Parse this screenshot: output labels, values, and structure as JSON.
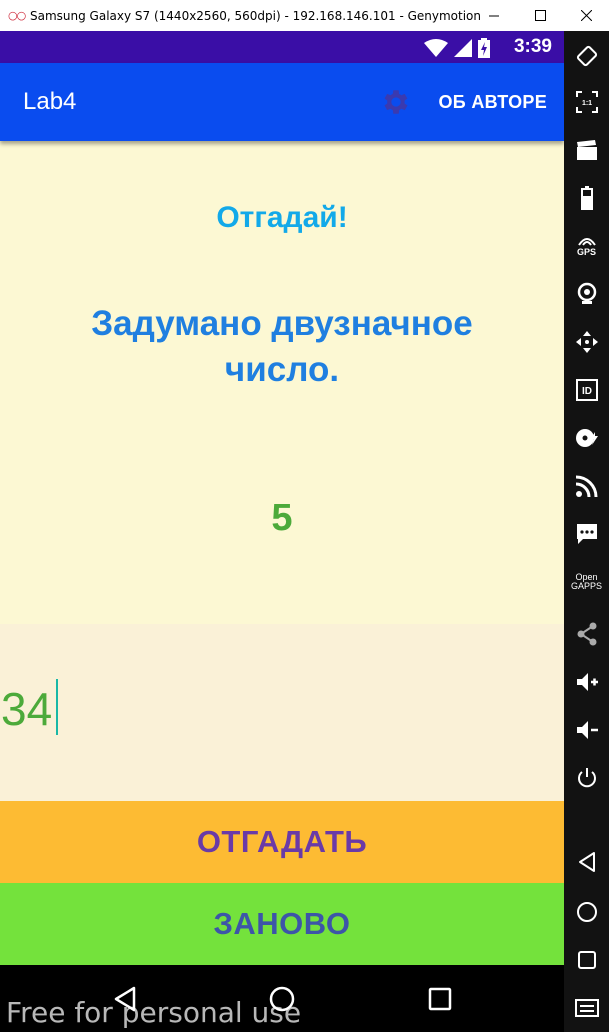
{
  "window": {
    "title": "Samsung Galaxy S7 (1440x2560, 560dpi) - 192.168.146.101 - Genymotion",
    "app_icon": "genymotion-icon",
    "controls": [
      "minimize-icon",
      "maximize-icon",
      "close-icon"
    ]
  },
  "statusbar": {
    "time": "3:39",
    "icons": [
      "wifi-icon",
      "signal-icon",
      "battery-charging-icon"
    ]
  },
  "appbar": {
    "title": "Lab4",
    "settings_icon": "gear-icon",
    "about_label": "ОБ АВТОРЕ"
  },
  "main": {
    "heading": "Отгадай!",
    "message": "Задумано двузначное число.",
    "number": "5"
  },
  "input": {
    "value": "34"
  },
  "buttons": {
    "guess_label": "ОТГАДАТЬ",
    "restart_label": "ЗАНОВО"
  },
  "navbar": {
    "icons": [
      "back-icon",
      "home-icon",
      "recents-icon"
    ]
  },
  "watermark": "Free for personal use",
  "sidebar": {
    "pixel_label": "1:1",
    "gps_label": "GPS",
    "id_label": "ID",
    "opengapps_label": "Open GAPPS",
    "icons": [
      "rotate-icon",
      "pixel-perfect-icon",
      "camera-clapper-icon",
      "battery-icon",
      "gps-icon",
      "webcam-icon",
      "move-icon",
      "device-id-icon",
      "disk-io-icon",
      "network-icon",
      "sms-icon",
      "opengapps-icon",
      "share-icon",
      "volume-up-icon",
      "volume-down-icon",
      "power-icon",
      "back-icon",
      "home-icon",
      "recents-icon",
      "menu-icon"
    ]
  },
  "colors": {
    "statusbar": "#3a0ea6",
    "appbar": "#0a4cef",
    "content_bg": "#fcf8d3",
    "heading": "#12a9e9",
    "message": "#1f7fe0",
    "number": "#4caa3a",
    "guess_button": "#fdbb33",
    "restart_button": "#74e23c"
  }
}
